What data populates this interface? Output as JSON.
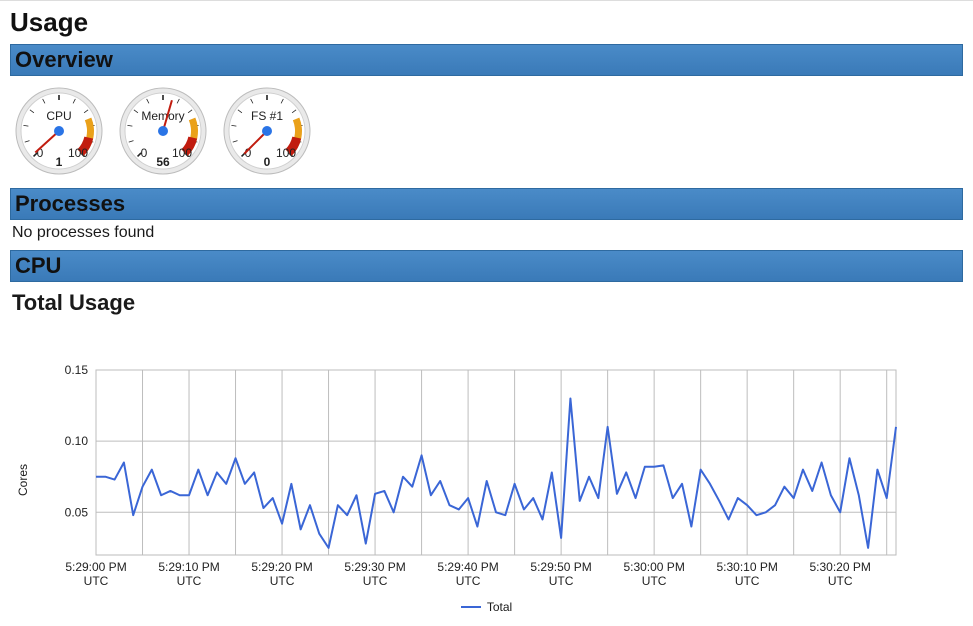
{
  "page": {
    "title": "Usage"
  },
  "sections": {
    "overview": "Overview",
    "processes": "Processes",
    "cpu": "CPU"
  },
  "gauges": [
    {
      "label": "CPU",
      "value": 1,
      "min": 0,
      "max_label": "100"
    },
    {
      "label": "Memory",
      "value": 56,
      "min": 0,
      "max_label": "100"
    },
    {
      "label": "FS #1",
      "value": 0,
      "min": 0,
      "max_label": "100"
    }
  ],
  "processes": {
    "empty_message": "No processes found"
  },
  "cpu_panel": {
    "subtitle": "Total Usage",
    "ylabel": "Cores",
    "legend": "Total"
  },
  "chart_data": {
    "type": "line",
    "title": "Total Usage",
    "xlabel": "",
    "ylabel": "Cores",
    "xticks": [
      "5:29:00 PM UTC",
      "5:29:10 PM UTC",
      "5:29:20 PM UTC",
      "5:29:30 PM UTC",
      "5:29:40 PM UTC",
      "5:29:50 PM UTC",
      "5:30:00 PM UTC",
      "5:30:10 PM UTC",
      "5:30:20 PM UTC"
    ],
    "yticks": [
      0.05,
      0.1,
      0.15
    ],
    "ylim": [
      0.02,
      0.15
    ],
    "series": [
      {
        "name": "Total",
        "x_seconds_from_start": [
          0,
          1,
          2,
          3,
          4,
          5,
          6,
          7,
          8,
          9,
          10,
          11,
          12,
          13,
          14,
          15,
          16,
          17,
          18,
          19,
          20,
          21,
          22,
          23,
          24,
          25,
          26,
          27,
          28,
          29,
          30,
          31,
          32,
          33,
          34,
          35,
          36,
          37,
          38,
          39,
          40,
          41,
          42,
          43,
          44,
          45,
          46,
          47,
          48,
          49,
          50,
          51,
          52,
          53,
          54,
          55,
          56,
          57,
          58,
          59,
          60,
          61,
          62,
          63,
          64,
          65,
          66,
          67,
          68,
          69,
          70,
          71,
          72,
          73,
          74,
          75,
          76,
          77,
          78,
          79,
          80,
          81,
          82,
          83,
          84,
          85,
          86
        ],
        "values": [
          0.075,
          0.075,
          0.073,
          0.085,
          0.048,
          0.068,
          0.08,
          0.062,
          0.065,
          0.062,
          0.062,
          0.08,
          0.062,
          0.078,
          0.07,
          0.088,
          0.07,
          0.078,
          0.053,
          0.06,
          0.042,
          0.07,
          0.038,
          0.055,
          0.035,
          0.025,
          0.055,
          0.048,
          0.062,
          0.028,
          0.063,
          0.065,
          0.05,
          0.075,
          0.068,
          0.09,
          0.062,
          0.072,
          0.055,
          0.052,
          0.06,
          0.04,
          0.072,
          0.05,
          0.048,
          0.07,
          0.052,
          0.06,
          0.045,
          0.078,
          0.032,
          0.13,
          0.058,
          0.075,
          0.06,
          0.11,
          0.063,
          0.078,
          0.06,
          0.082,
          0.082,
          0.083,
          0.06,
          0.07,
          0.04,
          0.08,
          0.07,
          0.058,
          0.045,
          0.06,
          0.055,
          0.048,
          0.05,
          0.055,
          0.068,
          0.06,
          0.08,
          0.065,
          0.085,
          0.062,
          0.05,
          0.088,
          0.062,
          0.025,
          0.08,
          0.06,
          0.11
        ]
      }
    ]
  }
}
